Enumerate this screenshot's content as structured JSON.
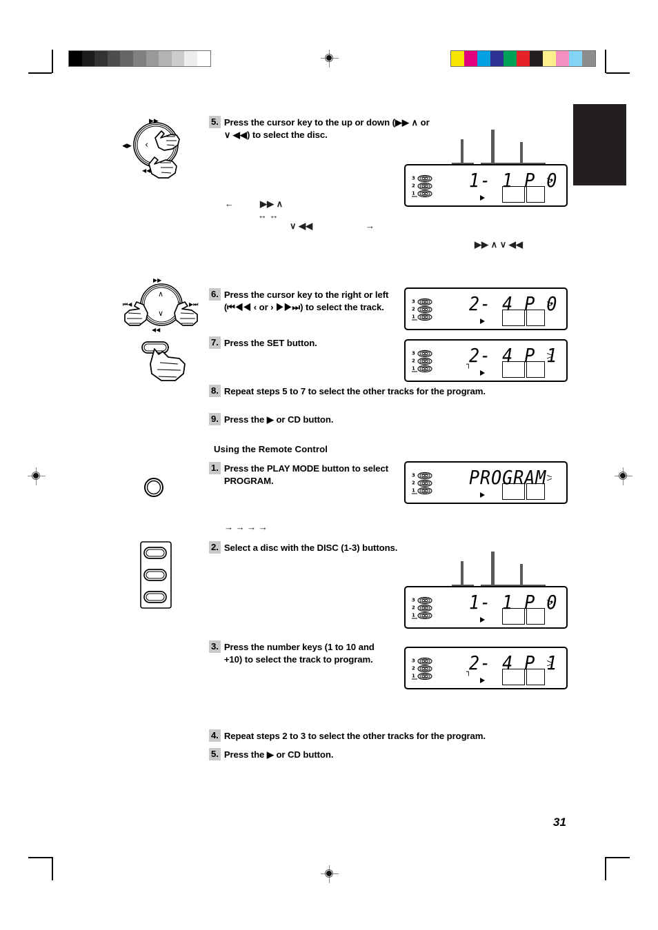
{
  "page": {
    "number": "31",
    "section_heading": "Using the Remote Control"
  },
  "steps_front_panel": [
    {
      "num": "5.",
      "text": "Press the cursor key to the up or down (▶▶ ∧ or ∨ ◀◀) to select the disc."
    },
    {
      "num": "6.",
      "text": "Press the cursor key to the right or left (⏮◀◀ ‹ or › ▶▶⏭) to select the track."
    },
    {
      "num": "7.",
      "text": "Press the SET button."
    },
    {
      "num": "8.",
      "text": "Repeat steps 5 to 7 to select the other tracks for the program."
    },
    {
      "num": "9.",
      "text": "Press the ▶ or CD button."
    }
  ],
  "steps_remote": [
    {
      "num": "1.",
      "text": "Press the PLAY MODE button to select PROGRAM."
    },
    {
      "num": "2.",
      "text": "Select a disc with the DISC (1-3) buttons."
    },
    {
      "num": "3.",
      "text": "Press the number keys (1 to 10 and +10) to select the track to program."
    },
    {
      "num": "4.",
      "text": "Repeat steps 2 to 3 to select the other tracks for the program."
    },
    {
      "num": "5.",
      "text": "Press the ▶ or CD button."
    }
  ],
  "floating_glyphs": [
    {
      "id": "glyph-left-arrow",
      "text": "←"
    },
    {
      "id": "glyph-ff-up",
      "text": "▶▶  ∧"
    },
    {
      "id": "glyph-dbl-arrows",
      "text": "↔    ↔"
    },
    {
      "id": "glyph-down-rew",
      "text": "∨ ◀◀"
    },
    {
      "id": "glyph-right-arrow",
      "text": "→"
    },
    {
      "id": "glyph-ff-up-rew-down",
      "text": "▶▶ ∧    ∨ ◀◀"
    },
    {
      "id": "glyph-flow-arrows",
      "text": "→              →             →             →"
    }
  ],
  "displays": [
    {
      "id": "display-disc-select-front",
      "segments": "1- 1 P 0",
      "disc_labels": [
        "3",
        "2",
        "1"
      ],
      "indicator": "▶",
      "side_mark": "ハ",
      "program_mark": "",
      "has_leaders": true,
      "boxes": 2
    },
    {
      "id": "display-track-select-front",
      "segments": "2- 4 P 0",
      "disc_labels": [
        "3",
        "2",
        "1"
      ],
      "indicator": "▶",
      "side_mark": "ハ",
      "program_mark": "",
      "has_leaders": false,
      "boxes": 2
    },
    {
      "id": "display-set-confirm-front",
      "segments": "2- 4 P 1",
      "disc_labels": [
        "3",
        "2",
        "1"
      ],
      "indicator": "▶",
      "side_mark": "ハ",
      "program_mark": "┐",
      "has_leaders": false,
      "boxes": 2
    },
    {
      "id": "display-program-mode-remote",
      "segments": "PROGRAM",
      "disc_labels": [
        "3",
        "2",
        "1"
      ],
      "indicator": "▶",
      "side_mark": "ハ",
      "program_mark": "",
      "has_leaders": false,
      "boxes": 2
    },
    {
      "id": "display-disc-select-remote",
      "segments": "1- 1 P 0",
      "disc_labels": [
        "3",
        "2",
        "1"
      ],
      "indicator": "▶",
      "side_mark": "ハ",
      "program_mark": "",
      "has_leaders": true,
      "boxes": 2
    },
    {
      "id": "display-track-entry-remote",
      "segments": "2- 4 P 1",
      "disc_labels": [
        "3",
        "2",
        "1"
      ],
      "indicator": "▶",
      "side_mark": "ハ",
      "program_mark": "┐",
      "has_leaders": false,
      "boxes": 2
    }
  ],
  "dial_labels": {
    "top": "▶▶",
    "left": "⏮◀◀",
    "right": "▶▶⏭",
    "bottom": "◀◀"
  },
  "calibration": {
    "grayscale": [
      "#000000",
      "#1c1c1c",
      "#333333",
      "#4d4d4d",
      "#666666",
      "#808080",
      "#999999",
      "#b3b3b3",
      "#cccccc",
      "#ededed",
      "#ffffff"
    ],
    "colors": [
      "#f5e500",
      "#e2007d",
      "#00a0e3",
      "#2e3191",
      "#00a158",
      "#e62129",
      "#231f20",
      "#fbf08a",
      "#f490c0",
      "#84d5f5",
      "#8d8d8d"
    ]
  },
  "marks": {
    "tab_color": "#231f20"
  }
}
